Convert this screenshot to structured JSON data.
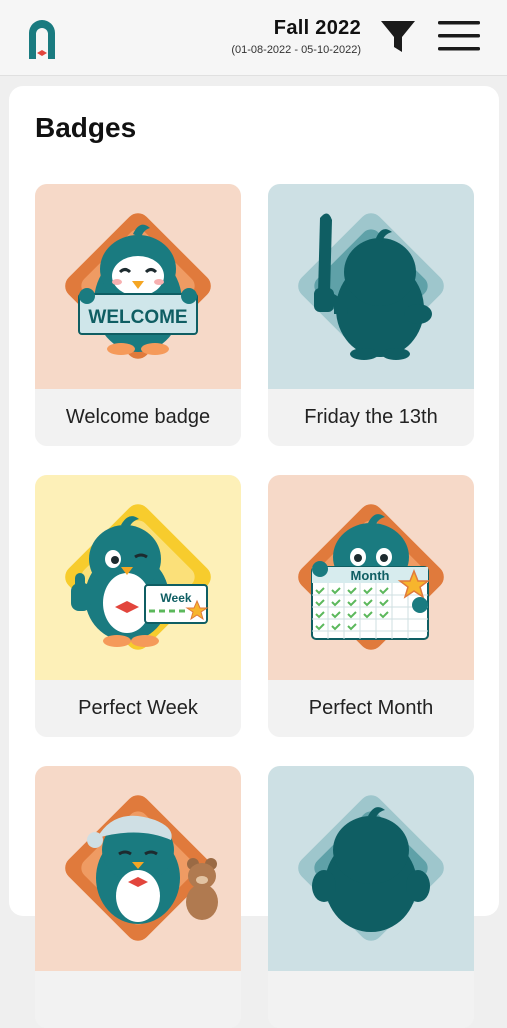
{
  "header": {
    "term_name": "Fall 2022",
    "term_dates": "(01-08-2022 - 05-10-2022)",
    "logo_icon": "app-logo-arch-icon",
    "filter_icon": "funnel-filter-icon",
    "menu_icon": "hamburger-menu-icon"
  },
  "page": {
    "title": "Badges"
  },
  "colors": {
    "teal_dark": "#0f5e63",
    "teal": "#1a7b80",
    "peach_bg": "#f6d9c8",
    "orange": "#e07a3c",
    "light_blue_bg": "#cde0e4",
    "yellow_bg": "#fdf0b8",
    "yellow": "#f7cc2d"
  },
  "badges": [
    {
      "label": "Welcome badge",
      "art_text": "WELCOME",
      "locked": false,
      "icon": "penguin-welcome-sign-icon"
    },
    {
      "label": "Friday the 13th",
      "art_text": "",
      "locked": true,
      "icon": "penguin-knife-silhouette-icon"
    },
    {
      "label": "Perfect Week",
      "art_text": "Week",
      "locked": false,
      "icon": "penguin-thumbs-up-week-calendar-icon"
    },
    {
      "label": "Perfect Month",
      "art_text": "Month",
      "locked": false,
      "icon": "penguin-month-calendar-icon"
    },
    {
      "label": "",
      "art_text": "",
      "locked": false,
      "icon": "penguin-sleepy-teddy-bear-icon"
    },
    {
      "label": "",
      "art_text": "",
      "locked": true,
      "icon": "penguin-silhouette-icon"
    }
  ]
}
